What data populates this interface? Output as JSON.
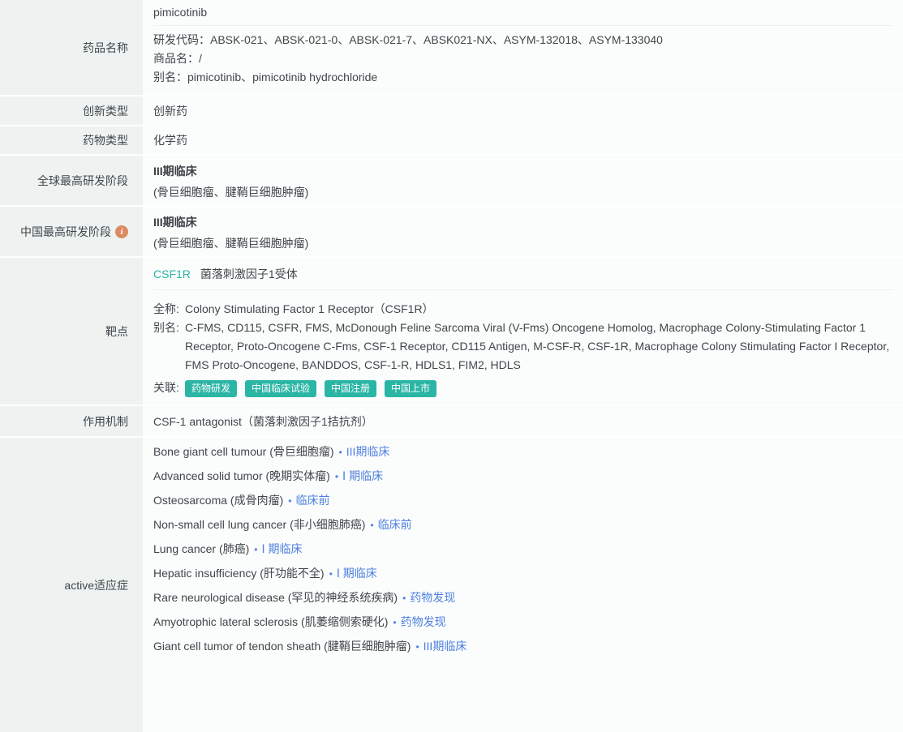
{
  "ui": {
    "bullet": "•",
    "info_icon_glyph": "i"
  },
  "colors": {
    "sidebar_bg": "#eef3f2",
    "content_bg": "#fbfcfc",
    "teal_accent": "#2bb5a5",
    "blue_link": "#4d80e0",
    "info_icon_bg": "#dd8a62",
    "text": "#41464b"
  },
  "labels": {
    "drug_name": "药品名称",
    "innovation_type": "创新类型",
    "drug_type": "药物类型",
    "global_stage": "全球最高研发阶段",
    "china_stage": "中国最高研发阶段",
    "target": "靶点",
    "moa": "作用机制",
    "indications": "active适应症"
  },
  "drug": {
    "name": "pimicotinib",
    "dev_codes_label": "研发代码：",
    "dev_codes": "ABSK-021、ABSK-021-0、ABSK-021-7、ABSK021-NX、ASYM-132018、ASYM-133040",
    "trade_name_label": "商品名：",
    "trade_name": "/",
    "alias_label": "别名：",
    "alias": "pimicotinib、pimicotinib hydrochloride",
    "innovation_type": "创新药",
    "drug_type": "化学药"
  },
  "global_stage": {
    "stage": "III期临床",
    "detail": "(骨巨细胞瘤、腱鞘巨细胞肿瘤)"
  },
  "china_stage": {
    "stage": "III期临床",
    "detail": "(骨巨细胞瘤、腱鞘巨细胞肿瘤)"
  },
  "target": {
    "symbol": "CSF1R",
    "name_cn": "菌落刺激因子1受体",
    "full_label": "全称:",
    "full_name": "Colony Stimulating Factor 1 Receptor（CSF1R）",
    "alias_label": "别名:",
    "alias": "C-FMS, CD115, CSFR, FMS, McDonough Feline Sarcoma Viral (V-Fms) Oncogene Homolog, Macrophage Colony-Stimulating Factor 1 Receptor, Proto-Oncogene C-Fms, CSF-1 Receptor, CD115 Antigen, M-CSF-R, CSF-1R, Macrophage Colony Stimulating Factor I Receptor, FMS Proto-Oncogene, BANDDOS, CSF-1-R, HDLS1, FIM2, HDLS",
    "links_label": "关联:",
    "links": [
      "药物研发",
      "中国临床试验",
      "中国注册",
      "中国上市"
    ]
  },
  "moa": {
    "text": "CSF-1 antagonist（菌落刺激因子1拮抗剂）"
  },
  "indications": [
    {
      "name": "Bone giant cell tumour (骨巨细胞瘤)",
      "stage": "III期临床"
    },
    {
      "name": "Advanced solid tumor (晚期实体瘤)",
      "stage": "Ⅰ 期临床"
    },
    {
      "name": "Osteosarcoma (成骨肉瘤)",
      "stage": "临床前"
    },
    {
      "name": "Non-small cell lung cancer (非小细胞肺癌)",
      "stage": "临床前"
    },
    {
      "name": "Lung cancer (肺癌)",
      "stage": "Ⅰ 期临床"
    },
    {
      "name": "Hepatic insufficiency (肝功能不全)",
      "stage": "Ⅰ 期临床"
    },
    {
      "name": "Rare neurological disease (罕见的神经系统疾病)",
      "stage": "药物发现"
    },
    {
      "name": "Amyotrophic lateral sclerosis (肌萎缩侧索硬化)",
      "stage": "药物发现"
    },
    {
      "name": "Giant cell tumor of tendon sheath (腱鞘巨细胞肿瘤)",
      "stage": "III期临床"
    }
  ]
}
